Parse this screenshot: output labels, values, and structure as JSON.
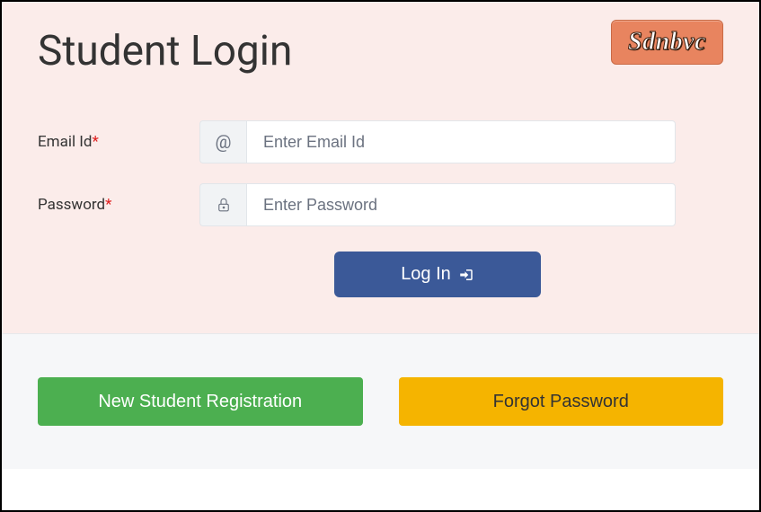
{
  "page": {
    "title": "Student Login"
  },
  "brand": {
    "name": "Sdnbvc"
  },
  "form": {
    "email": {
      "label": "Email Id",
      "placeholder": "Enter Email Id",
      "addon_symbol": "@"
    },
    "password": {
      "label": "Password",
      "placeholder": "Enter Password"
    },
    "required_mark": "*",
    "login_button": "Log In"
  },
  "footer": {
    "register": "New Student Registration",
    "forgot": "Forgot Password"
  }
}
